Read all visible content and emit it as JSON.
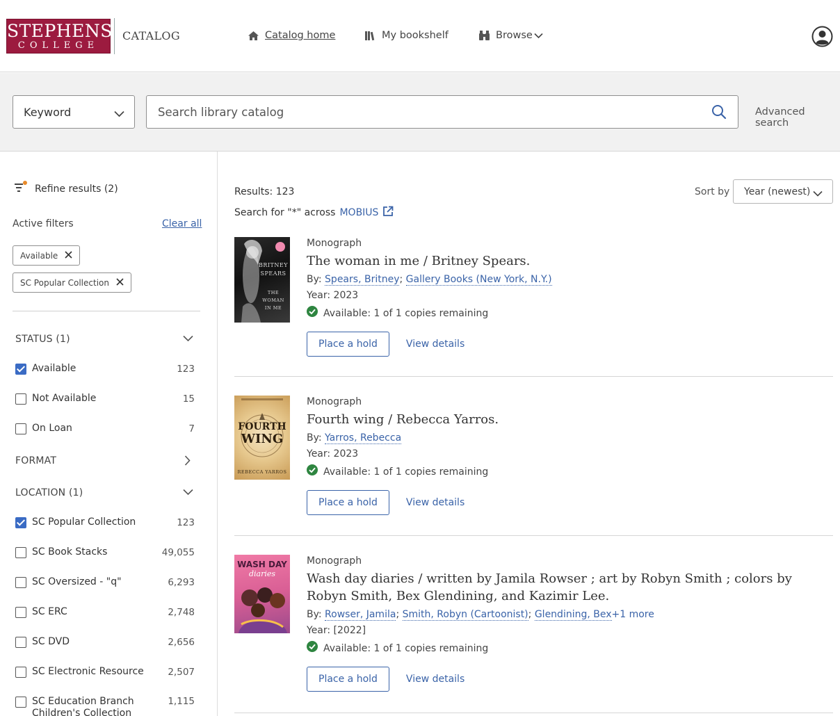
{
  "header": {
    "logo_line1": "STEPHENS",
    "logo_line2": "COLLEGE",
    "catalog_word": "CATALOG",
    "nav": {
      "home": "Catalog home",
      "bookshelf": "My bookshelf",
      "browse": "Browse"
    }
  },
  "search": {
    "scope": "Keyword",
    "placeholder": "Search library catalog",
    "advanced": "Advanced search"
  },
  "sidebar": {
    "refine": "Refine results (2)",
    "active_filters_label": "Active filters",
    "clear_all": "Clear all",
    "chips": [
      "Available",
      "SC Popular Collection"
    ],
    "status": {
      "heading": "STATUS (1)",
      "options": [
        {
          "label": "Available",
          "count": "123",
          "checked": true
        },
        {
          "label": "Not Available",
          "count": "15",
          "checked": false
        },
        {
          "label": "On Loan",
          "count": "7",
          "checked": false
        }
      ]
    },
    "format": {
      "heading": "FORMAT"
    },
    "location": {
      "heading": "LOCATION (1)",
      "options": [
        {
          "label": "SC Popular Collection",
          "count": "123",
          "checked": true
        },
        {
          "label": "SC Book Stacks",
          "count": "49,055",
          "checked": false
        },
        {
          "label": "SC Oversized - \"q\"",
          "count": "6,293",
          "checked": false
        },
        {
          "label": "SC ERC",
          "count": "2,748",
          "checked": false
        },
        {
          "label": "SC DVD",
          "count": "2,656",
          "checked": false
        },
        {
          "label": "SC Electronic Resource",
          "count": "2,507",
          "checked": false
        },
        {
          "label": "SC Education Branch Children's Collection",
          "count": "1,115",
          "checked": false
        }
      ]
    }
  },
  "main": {
    "results": "Results: 123",
    "search_across_prefix": "Search for \"*\" across",
    "search_across_link": "MOBIUS",
    "sort_label": "Sort by",
    "sort_value": "Year (newest)",
    "items": [
      {
        "type": "Monograph",
        "title": "The woman in me / Britney Spears.",
        "by_label": "By:",
        "authors": [
          "Spears, Britney",
          "Gallery Books (New York, N.Y.)"
        ],
        "more": "",
        "year": "Year: 2023",
        "availability": "Available: 1 of 1 copies remaining",
        "hold": "Place a hold",
        "details": "View details",
        "cover": {
          "line1": "BRITNEY",
          "line2": "SPEARS",
          "line3": "THE",
          "line4": "WOMAN",
          "line5": "IN ME"
        }
      },
      {
        "type": "Monograph",
        "title": "Fourth wing / Rebecca Yarros.",
        "by_label": "By:",
        "authors": [
          "Yarros, Rebecca"
        ],
        "more": "",
        "year": "Year: 2023",
        "availability": "Available: 1 of 1 copies remaining",
        "hold": "Place a hold",
        "details": "View details",
        "cover": {
          "line1": "FOURTH",
          "line2": "WING",
          "line3": "REBECCA YARROS"
        }
      },
      {
        "type": "Monograph",
        "title": "Wash day diaries / written by Jamila Rowser ; art by Robyn Smith ; colors by Robyn Smith, Bex Glendining, and Kazimir Lee.",
        "by_label": "By:",
        "authors": [
          "Rowser, Jamila",
          "Smith, Robyn (Cartoonist)",
          "Glendining, Bex"
        ],
        "more": "+1 more",
        "year": "Year: [2022]",
        "availability": "Available: 1 of 1 copies remaining",
        "hold": "Place a hold",
        "details": "View details",
        "cover": {
          "line1": "WASH DAY",
          "line2": "diaries"
        }
      }
    ]
  },
  "colors": {
    "brand": "#9c1b3f",
    "link": "#3a63a8",
    "available_green": "#2e8540",
    "checkbox": "#3a6bc4",
    "band": "#f1f1f1"
  }
}
